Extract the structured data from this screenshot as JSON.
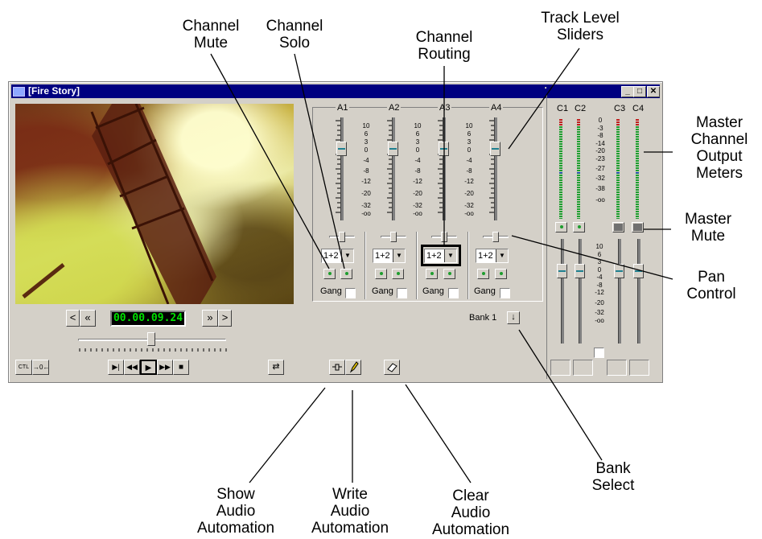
{
  "window": {
    "title": "[Fire Story]"
  },
  "titlebar_buttons": [
    "_",
    "□",
    "✕"
  ],
  "transport": {
    "timecode": "00.00.09.24",
    "prev_frame": "<",
    "rewind_nav": "«",
    "forward_nav": "»",
    "next_frame": ">",
    "ctl_label": "CTL",
    "in_out_label": "→0←",
    "play_in_out": "▶|",
    "rewind": "◀◀",
    "play": "▶",
    "fast_forward": "▶▶",
    "stop": "■",
    "loop_icon": "⇄"
  },
  "mixer": {
    "channels": [
      {
        "name": "A1",
        "routing": "1+2",
        "gang_label": "Gang",
        "level_db": 0
      },
      {
        "name": "A2",
        "routing": "1+2",
        "gang_label": "Gang",
        "level_db": 0
      },
      {
        "name": "A3",
        "routing": "1+2",
        "gang_label": "Gang",
        "level_db": 0
      },
      {
        "name": "A4",
        "routing": "1+2",
        "gang_label": "Gang",
        "level_db": 0
      }
    ],
    "scale": [
      "10",
      "6",
      "3",
      "0",
      "-4",
      "-8",
      "-12",
      "-20",
      "-32",
      "-oo"
    ],
    "bank_label": "Bank 1",
    "bank_arrow": "↓"
  },
  "master": {
    "channels": [
      "C1",
      "C2",
      "C3",
      "C4"
    ],
    "meter_scale": [
      "0",
      "-3",
      "-8",
      "-14",
      "-20",
      "-23",
      "-27",
      "-32",
      "-38",
      "-oo"
    ],
    "fader_scale": [
      "10",
      "6",
      "3",
      "0",
      "-4",
      "-8",
      "-12",
      "-20",
      "-32",
      "-oo"
    ]
  },
  "annotations": {
    "channel_mute": "Channel\nMute",
    "channel_solo": "Channel\nSolo",
    "channel_routing": "Channel\nRouting",
    "track_level_sliders": "Track Level\nSliders",
    "master_channel_output_meters": "Master\nChannel\nOutput\nMeters",
    "master_mute": "Master\nMute",
    "pan_control": "Pan\nControl",
    "bank_select": "Bank\nSelect",
    "show_audio_automation": "Show\nAudio\nAutomation",
    "write_audio_automation": "Write\nAudio\nAutomation",
    "clear_audio_automation": "Clear\nAudio\nAutomation"
  },
  "colors": {
    "titlebar": "#000080",
    "window": "#d4d0c8",
    "timecode": "#00e000",
    "meter_green": "#1fa030",
    "meter_blue": "#2040c0",
    "meter_red": "#c02020"
  }
}
